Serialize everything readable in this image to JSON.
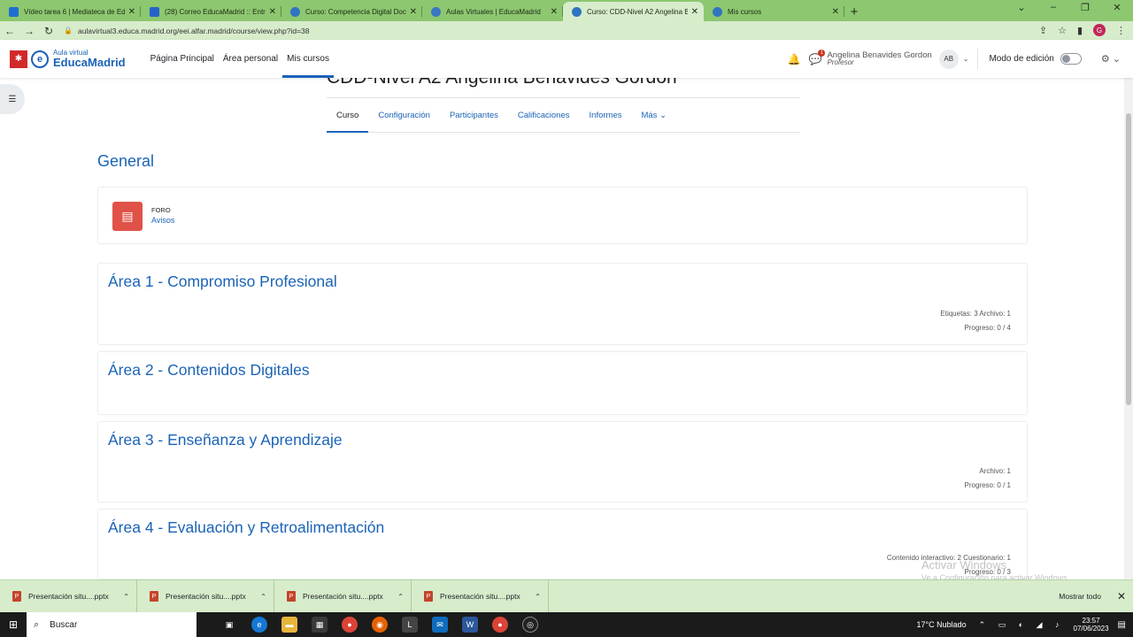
{
  "browser": {
    "tabs": [
      {
        "title": "Vídeo tarea 6 | Mediateca de Ed...",
        "color": "#1f6fd1"
      },
      {
        "title": "(28) Correo EducaMadrid :: Entra...",
        "color": "#2563c9"
      },
      {
        "title": "Curso: Competencia Digital Doce...",
        "color": "#2f74c0"
      },
      {
        "title": "Aulas Virtuales | EducaMadrid",
        "color": "#3a78c4"
      },
      {
        "title": "Curso: CDD-Nivel A2 Angelina Be...",
        "color": "#2f74c0"
      },
      {
        "title": "Mis cursos",
        "color": "#2f74c0"
      }
    ],
    "url": "aulavirtual3.educa.madrid.org/eei.alfar.madrid/course/view.php?id=38"
  },
  "navbar": {
    "logo_small": "Aula virtual",
    "logo_big": "EducaMadrid",
    "links": [
      "Página Principal",
      "Área personal",
      "Mis cursos"
    ],
    "notif_count": "1",
    "user_name": "Angelina Benavides Gordon",
    "user_role": "Profesor",
    "user_initials": "AB",
    "edit_mode_label": "Modo de edición"
  },
  "course": {
    "title": "CDD-Nivel A2 Angelina Benavides Gordon",
    "tabs": [
      "Curso",
      "Configuración",
      "Participantes",
      "Calificaciones",
      "Informes",
      "Más ⌄"
    ]
  },
  "general": {
    "heading": "General",
    "forum_type": "FORO",
    "forum_name": "Avisos"
  },
  "sections": [
    {
      "title": "Área 1 - Compromiso Profesional",
      "meta1": "Etiquetas: 3   Archivo: 1",
      "meta2": "Progreso: 0 / 4"
    },
    {
      "title": "Área 2 - Contenidos Digitales",
      "meta1": "",
      "meta2": ""
    },
    {
      "title": "Área 3 - Enseñanza y Aprendizaje",
      "meta1": "Archivo: 1",
      "meta2": "Progreso: 0 / 1"
    },
    {
      "title": "Área 4 - Evaluación y Retroalimentación",
      "meta1": "Contenido interactivo: 2   Cuestionario: 1",
      "meta2": "Progreso: 0 / 3"
    }
  ],
  "watermark": {
    "line1": "Activar Windows",
    "line2": "Ve a Configuración para activar Windows."
  },
  "downloads": {
    "items": [
      "Presentación situ....pptx",
      "Presentación situ....pptx",
      "Presentación situ....pptx",
      "Presentación situ....pptx"
    ],
    "show_all": "Mostrar todo"
  },
  "taskbar": {
    "search_label": "Buscar",
    "weather": "17°C  Nublado",
    "time": "23:57",
    "date": "07/06/2023"
  }
}
